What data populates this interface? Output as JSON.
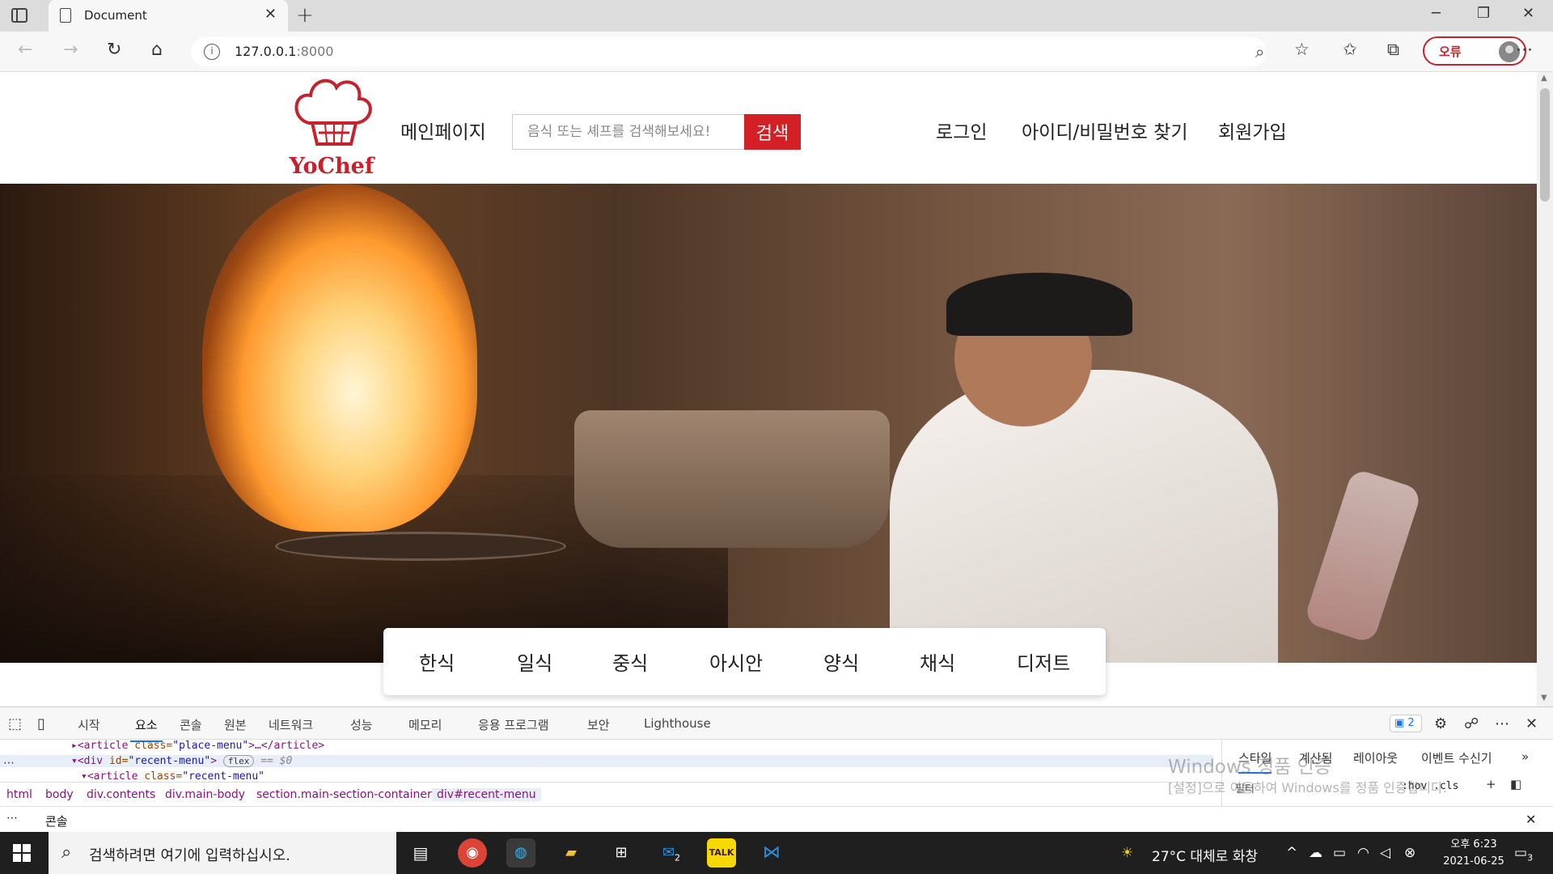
{
  "browser": {
    "tab_title": "Document",
    "url_host": "127.0.0.1",
    "url_port": ":8000",
    "profile_label": "오류"
  },
  "site": {
    "brand": "YoChef",
    "nav_main": "메인페이지",
    "search_placeholder": "음식 또는 셰프를 검색해보세요!",
    "search_button": "검색",
    "login": "로그인",
    "find_account": "아이디/비밀번호 찾기",
    "signup": "회원가입",
    "categories": [
      "한식",
      "일식",
      "중식",
      "아시안",
      "양식",
      "채식",
      "디저트"
    ]
  },
  "devtools": {
    "tabs": [
      "시작",
      "요소",
      "콘솔",
      "원본",
      "네트워크",
      "성능",
      "메모리",
      "응용 프로그램",
      "보안",
      "Lighthouse"
    ],
    "active_tab": "요소",
    "issues_count": "2",
    "dom": {
      "line1_open": "<article ",
      "line1_attr": "class=",
      "line1_val": "\"place-menu\"",
      "line1_close": ">…</article>",
      "line2_open": "<div ",
      "line2_attr": "id=",
      "line2_val": "\"recent-menu\"",
      "line2_close": ">",
      "line2_badge": "flex",
      "line2_eq": "== $0",
      "line3_open": "<article ",
      "line3_attr": "class=",
      "line3_val": "\"recent-menu\""
    },
    "breadcrumbs": [
      "html",
      "body",
      "div.contents",
      "div.main-body",
      "section.main-section-container",
      "div#recent-menu"
    ],
    "styles_tabs": [
      "스타일",
      "계산됨",
      "레이아웃",
      "이벤트 수신기"
    ],
    "filter_label": "필터",
    "hov_cls": ":hov .cls",
    "drawer_label": "콘솔",
    "activate_title": "Windows 정품 인증",
    "activate_sub": "[설정]으로 이동하여 Windows를 정품 인증합니다."
  },
  "taskbar": {
    "search_placeholder": "검색하려면 여기에 입력하십시오.",
    "weather": "27°C 대체로 화창",
    "time": "오후 6:23",
    "date": "2021-06-25",
    "notif_count": "3",
    "mail_badge": "2"
  }
}
